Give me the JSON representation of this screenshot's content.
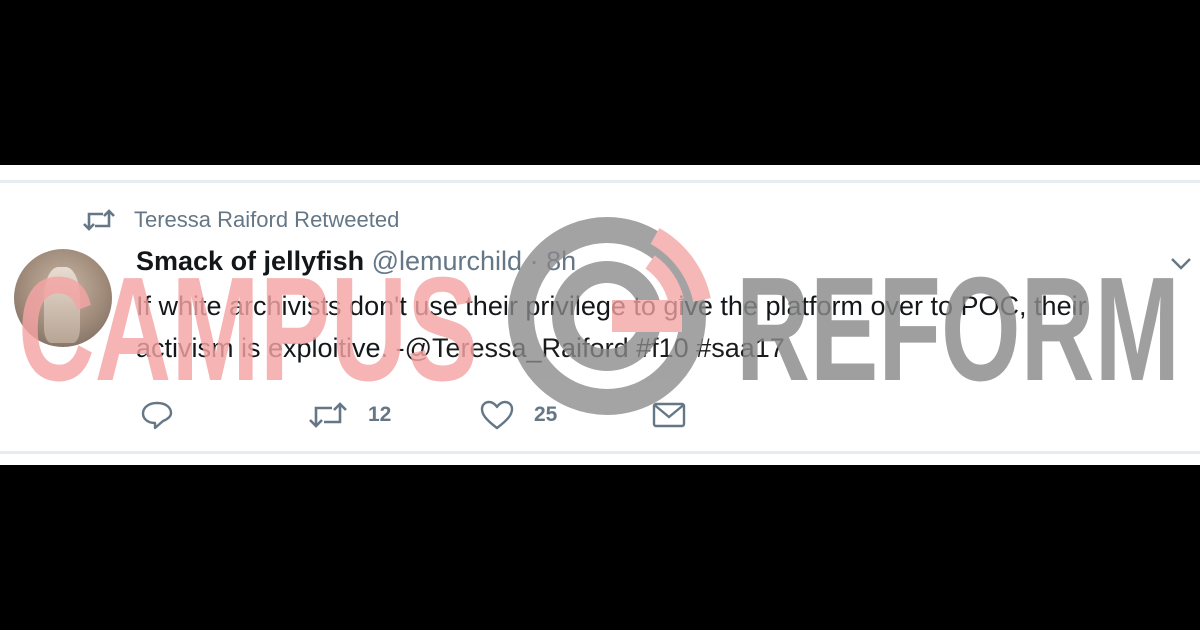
{
  "retweet_context": {
    "label": "Teressa Raiford Retweeted",
    "icon": "retweet-icon"
  },
  "tweet": {
    "display_name": "Smack of jellyfish",
    "screen_name": "@lemurchild",
    "separator": "·",
    "time": "8h",
    "text_part1": "If white archivists don't use their privilege to give the platform over to POC, their activism is exploitive. -",
    "mention": "@Teressa_Raiford",
    "hashtag1": "#f10",
    "hashtag2": "#saa17"
  },
  "actions": {
    "reply": {
      "icon": "reply-icon",
      "count": ""
    },
    "retweet": {
      "icon": "retweet-icon",
      "count": "12"
    },
    "like": {
      "icon": "heart-icon",
      "count": "25"
    },
    "message": {
      "icon": "envelope-icon"
    }
  },
  "watermark": {
    "word1": "CAMPUS",
    "word2": "REFORM",
    "colors": {
      "campus": "#f4a3a3",
      "reform": "#8a8a8a"
    }
  },
  "colors": {
    "background": "#000000",
    "panel": "#ffffff",
    "muted_text": "#657786",
    "body_text": "#14171a"
  }
}
